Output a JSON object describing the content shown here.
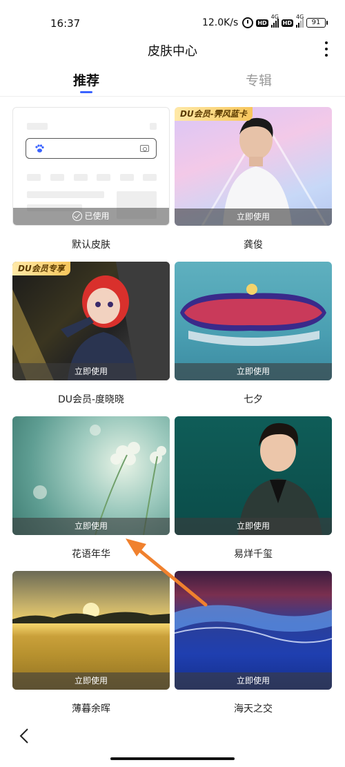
{
  "status_bar": {
    "time": "16:37",
    "speed": "12.0K/s",
    "hd1": "HD",
    "hd2": "HD",
    "net1": "4G",
    "net2": "4G",
    "battery": "91"
  },
  "header": {
    "title": "皮肤中心",
    "more_icon": "more-vertical-icon"
  },
  "tabs": [
    {
      "label": "推荐",
      "active": true
    },
    {
      "label": "专辑",
      "active": false
    }
  ],
  "skins": [
    {
      "name": "默认皮肤",
      "action": "已使用",
      "used": true
    },
    {
      "name": "龚俊",
      "action": "立即使用",
      "used": false,
      "tag": "DU会员-霁风蓝卡"
    },
    {
      "name": "DU会员-度晓晓",
      "action": "立即使用",
      "used": false,
      "tag": "DU会员专享"
    },
    {
      "name": "七夕",
      "action": "立即使用",
      "used": false
    },
    {
      "name": "花语年华",
      "action": "立即使用",
      "used": false
    },
    {
      "name": "易烊千玺",
      "action": "立即使用",
      "used": false
    },
    {
      "name": "薄暮余晖",
      "action": "立即使用",
      "used": false
    },
    {
      "name": "海天之交",
      "action": "立即使用",
      "used": false
    }
  ],
  "colors": {
    "accent": "#3a63ff",
    "arrow": "#f0812e"
  }
}
